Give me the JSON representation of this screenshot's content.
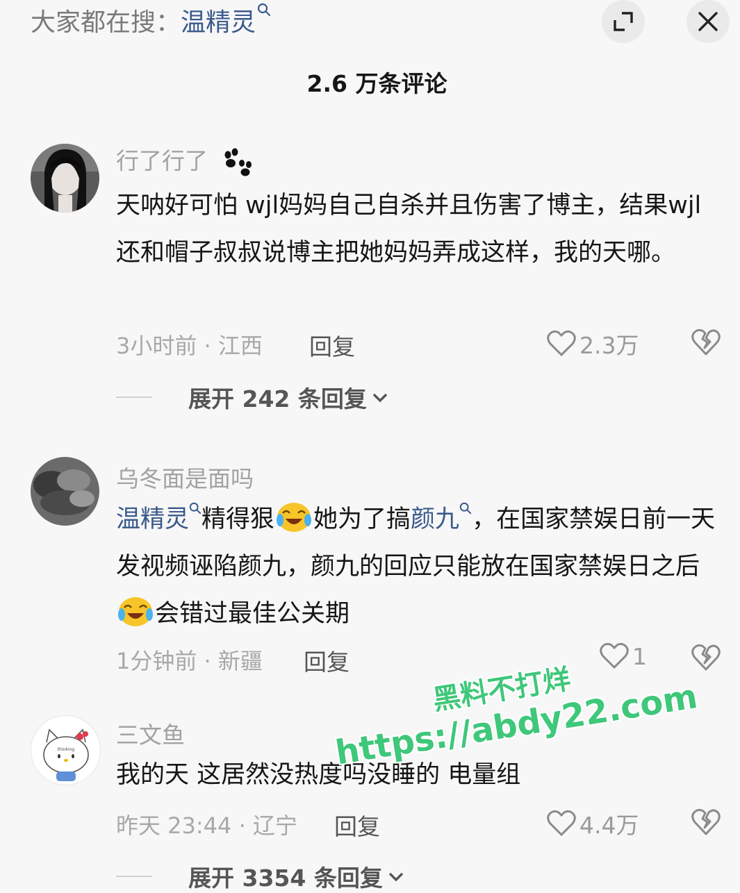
{
  "search_hint": {
    "prefix": "大家都在搜：",
    "term": "温精灵"
  },
  "header": {
    "title": "2.6 万条评论"
  },
  "comments": [
    {
      "username": "行了行了",
      "text": "天呐好可怕 wjl妈妈自己自杀并且伤害了博主，结果wjl还和帽子叔叔说博主把她妈妈弄成这样，我的天哪。",
      "time_location": "3小时前 · 江西",
      "reply_label": "回复",
      "likes": "2.3万",
      "expand_label": "展开 242 条回复"
    },
    {
      "username": "乌冬面是面吗",
      "text_parts": [
        "温精灵",
        "精得狠",
        "她为了搞",
        "颜九",
        "，在国家禁娱日前一天发视频诬陷颜九，颜九的回应只能放在国家禁娱日之后",
        "会错过最佳公关期"
      ],
      "time_location": "1分钟前 · 新疆",
      "reply_label": "回复",
      "likes": "1"
    },
    {
      "username": "三文鱼",
      "avatar_text": "thinking",
      "text": "我的天 这居然没热度吗没睡的 电量组",
      "time_location": "昨天 23:44 · 辽宁",
      "reply_label": "回复",
      "likes": "4.4万",
      "expand_label": "展开 3354 条回复"
    }
  ],
  "watermark": {
    "line1": "黑料不打烊",
    "line2": "https://abdy22.com"
  },
  "colors": {
    "link": "#3a5a8c",
    "meta": "#a8a8a8",
    "watermark": "#3fc77a",
    "background": "#f7f7f7"
  }
}
